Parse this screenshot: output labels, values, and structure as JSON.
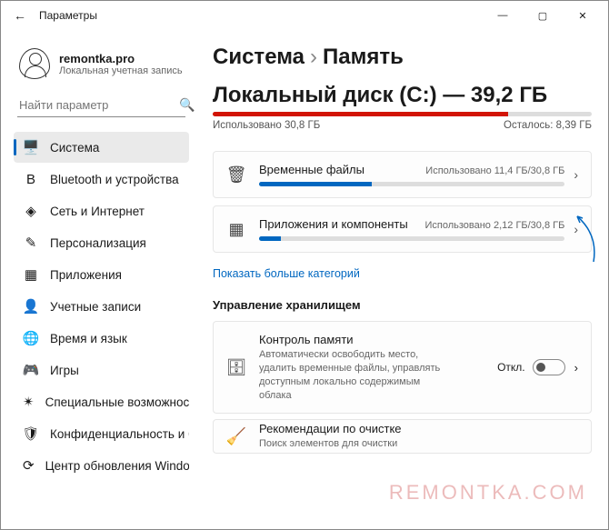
{
  "window": {
    "title": "Параметры"
  },
  "user": {
    "name": "remontka.pro",
    "sub": "Локальная учетная запись"
  },
  "search": {
    "placeholder": "Найти параметр"
  },
  "nav": {
    "items": [
      {
        "label": "Система",
        "icon": "🖥️",
        "active": true
      },
      {
        "label": "Bluetooth и устройства",
        "icon": "B"
      },
      {
        "label": "Сеть и Интернет",
        "icon": "◈"
      },
      {
        "label": "Персонализация",
        "icon": "✎"
      },
      {
        "label": "Приложения",
        "icon": "▦"
      },
      {
        "label": "Учетные записи",
        "icon": "👤"
      },
      {
        "label": "Время и язык",
        "icon": "🌐"
      },
      {
        "label": "Игры",
        "icon": "🎮"
      },
      {
        "label": "Специальные возможности",
        "icon": "✴"
      },
      {
        "label": "Конфиденциальность и безопасность",
        "icon": "🛡"
      },
      {
        "label": "Центр обновления Windows",
        "icon": "⟳"
      }
    ]
  },
  "crumb": {
    "a": "Система",
    "b": "Память"
  },
  "disk": {
    "title": "Локальный диск (C:) — 39,2 ГБ",
    "used": "Использовано 30,8 ГБ",
    "left": "Осталось: 8,39 ГБ"
  },
  "cat": [
    {
      "title": "Временные файлы",
      "used": "Использовано 11,4 ГБ/30,8 ГБ",
      "pct": 37
    },
    {
      "title": "Приложения и компоненты",
      "used": "Использовано 2,12 ГБ/30,8 ГБ",
      "pct": 7
    }
  ],
  "more": "Показать больше категорий",
  "sect": "Управление хранилищем",
  "mgmt": {
    "title": "Контроль памяти",
    "sub": "Автоматически освободить место, удалить временные файлы, управлять доступным локально содержимым облака",
    "state": "Откл."
  },
  "rec": {
    "title": "Рекомендации по очистке",
    "sub": "Поиск элементов для очистки"
  },
  "watermark": "REMONTKA.COM"
}
